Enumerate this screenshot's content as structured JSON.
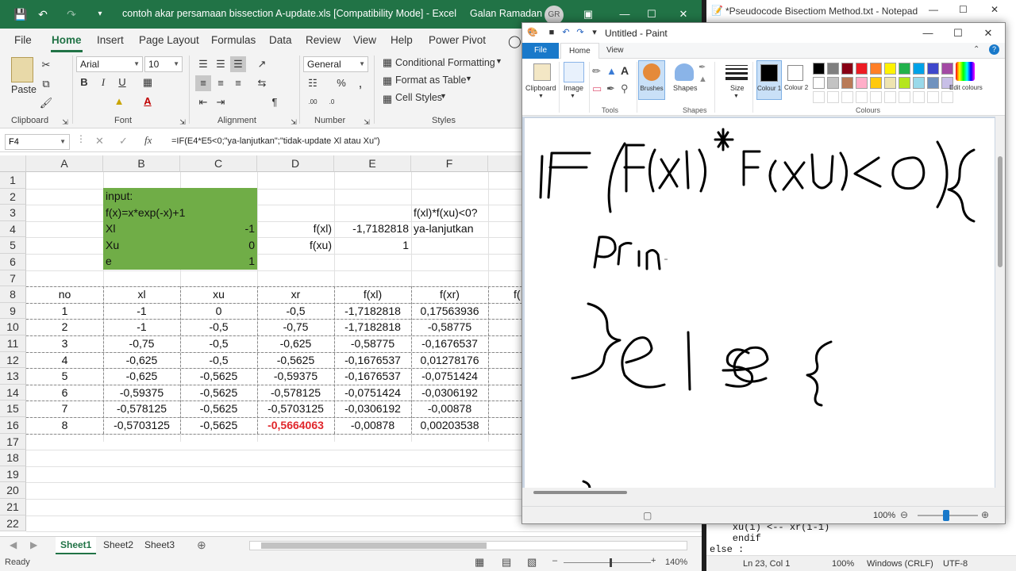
{
  "excel": {
    "title": "contoh akar persamaan bissection A-update.xls  [Compatibility Mode]  -  Excel",
    "user": "Galan Ramadan",
    "avatar": "GR",
    "tabs": [
      "File",
      "Home",
      "Insert",
      "Page Layout",
      "Formulas",
      "Data",
      "Review",
      "View",
      "Help",
      "Power Pivot"
    ],
    "active_tab": "Home",
    "ribbon": {
      "paste": "Paste",
      "font_name": "Arial",
      "font_size": "10",
      "number_format": "General",
      "conditional_formatting": "Conditional Formatting",
      "format_as_table": "Format as Table",
      "cell_styles": "Cell Styles",
      "groups": {
        "clipboard": "Clipboard",
        "font": "Font",
        "alignment": "Alignment",
        "number": "Number",
        "styles": "Styles"
      }
    },
    "name_box": "F4",
    "formula": "=IF(E4*E5<0;\"ya-lanjutkan\";\"tidak-update Xl atau Xu\")",
    "columns": [
      "A",
      "B",
      "C",
      "D",
      "E",
      "F"
    ],
    "rows": [
      "1",
      "2",
      "3",
      "4",
      "5",
      "6",
      "7",
      "8",
      "9",
      "10",
      "11",
      "12",
      "13",
      "14",
      "15",
      "16",
      "17",
      "18",
      "19",
      "20",
      "21",
      "22"
    ],
    "inputs": {
      "label": "input:",
      "fx": "f(x)=x*exp(-x)+1",
      "xl_label": "Xl",
      "xl_value": "-1",
      "xu_label": "Xu",
      "xu_value": "0",
      "e_label": "e",
      "e_value": "1",
      "fxl_label": "f(xl)",
      "fxl_value": "-1,7182818",
      "fxu_label": "f(xu)",
      "fxu_value": "1",
      "check_label": "f(xl)*f(xu)<0?",
      "check_value": "ya-lanjutkan"
    },
    "table_headers": [
      "no",
      "xl",
      "xu",
      "xr",
      "f(xl)",
      "f(xr)",
      "f("
    ],
    "table_rows": [
      [
        "1",
        "-1",
        "0",
        "-0,5",
        "-1,7182818",
        "0,17563936"
      ],
      [
        "2",
        "-1",
        "-0,5",
        "-0,75",
        "-1,7182818",
        "-0,58775"
      ],
      [
        "3",
        "-0,75",
        "-0,5",
        "-0,625",
        "-0,58775",
        "-0,1676537"
      ],
      [
        "4",
        "-0,625",
        "-0,5",
        "-0,5625",
        "-0,1676537",
        "0,01278176"
      ],
      [
        "5",
        "-0,625",
        "-0,5625",
        "-0,59375",
        "-0,1676537",
        "-0,0751424"
      ],
      [
        "6",
        "-0,59375",
        "-0,5625",
        "-0,578125",
        "-0,0751424",
        "-0,0306192"
      ],
      [
        "7",
        "-0,578125",
        "-0,5625",
        "-0,5703125",
        "-0,0306192",
        "-0,00878"
      ],
      [
        "8",
        "-0,5703125",
        "-0,5625",
        "-0,5664063",
        "-0,00878",
        "0,00203538"
      ]
    ],
    "highlight_color": "#e0262b",
    "green": "#70ad47",
    "accent": "#217346",
    "sheets": [
      "Sheet1",
      "Sheet2",
      "Sheet3"
    ],
    "status": "Ready",
    "zoom": "140%"
  },
  "notepad": {
    "title": "*Pseudocode Bisectiom Method.txt - Notepad",
    "lines": [
      "    xu(i) <-- xr(i-1)",
      "    endif",
      "else :"
    ],
    "status": {
      "position": "Ln 23, Col 1",
      "zoom": "100%",
      "eol": "Windows (CRLF)",
      "encoding": "UTF-8"
    }
  },
  "paint": {
    "title": "Untitled - Paint",
    "tabs": [
      "File",
      "Home",
      "View"
    ],
    "groups": {
      "clipboard": "Clipboard",
      "image": "Image",
      "tools": "Tools",
      "brushes": "Brushes",
      "shapes": "Shapes",
      "size": "Size",
      "colour1": "Colour 1",
      "colour2": "Colour 2",
      "edit_colours": "Edit colours",
      "colours": "Colours"
    },
    "palette_row1": [
      "#000000",
      "#7f7f7f",
      "#880015",
      "#ed1c24",
      "#ff7f27",
      "#fff200",
      "#22b14c",
      "#00a2e8",
      "#3f48cc",
      "#a349a4"
    ],
    "palette_row2": [
      "#ffffff",
      "#c3c3c3",
      "#b97a57",
      "#ffaec9",
      "#ffc90e",
      "#efe4b0",
      "#b5e61d",
      "#99d9ea",
      "#7092be",
      "#c8bfe7"
    ],
    "zoom": "100%"
  }
}
